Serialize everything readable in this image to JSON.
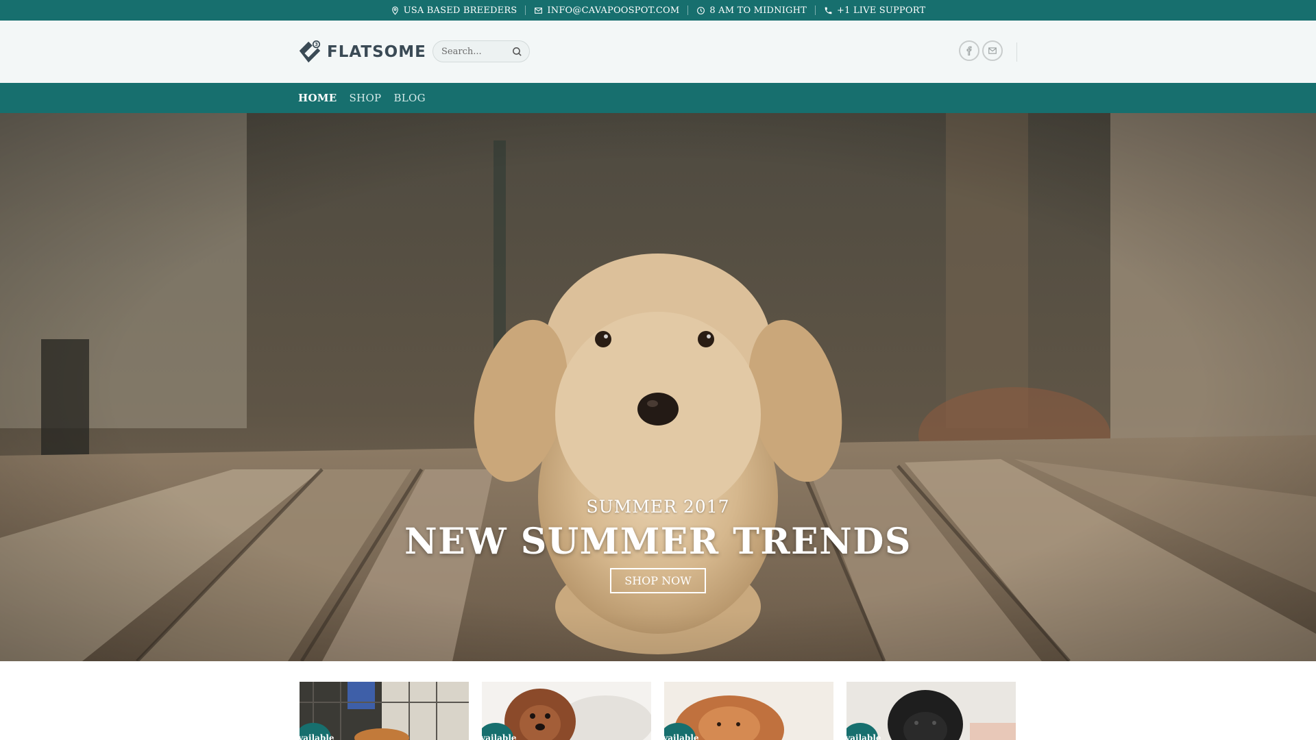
{
  "topbar": {
    "items": [
      {
        "icon": "map-pin-icon",
        "label": "USA BASED BREEDERS"
      },
      {
        "icon": "envelope-icon",
        "label": "INFO@CAVAPOOSPOT.COM"
      },
      {
        "icon": "clock-icon",
        "label": "8 AM TO MIDNIGHT"
      },
      {
        "icon": "phone-icon",
        "label": "+1 LIVE SUPPORT"
      }
    ],
    "background": "#176f6e"
  },
  "header": {
    "logo_text": "FLATSOME",
    "search": {
      "placeholder": "Search..."
    },
    "social": [
      {
        "icon": "facebook-icon",
        "label": "f"
      },
      {
        "icon": "email-icon",
        "label": "✉"
      }
    ]
  },
  "nav": {
    "items": [
      {
        "label": "HOME",
        "active": true
      },
      {
        "label": "SHOP",
        "active": false
      },
      {
        "label": "BLOG",
        "active": false
      }
    ]
  },
  "hero": {
    "subtitle": "SUMMER 2017",
    "title": "NEW SUMMER TRENDS",
    "button_label": "SHOP NOW"
  },
  "products": [
    {
      "badge": "Available"
    },
    {
      "badge": "Available"
    },
    {
      "badge": "Available"
    },
    {
      "badge": "Available"
    }
  ],
  "colors": {
    "accent": "#176f6e",
    "header_bg": "#f3f7f7"
  }
}
